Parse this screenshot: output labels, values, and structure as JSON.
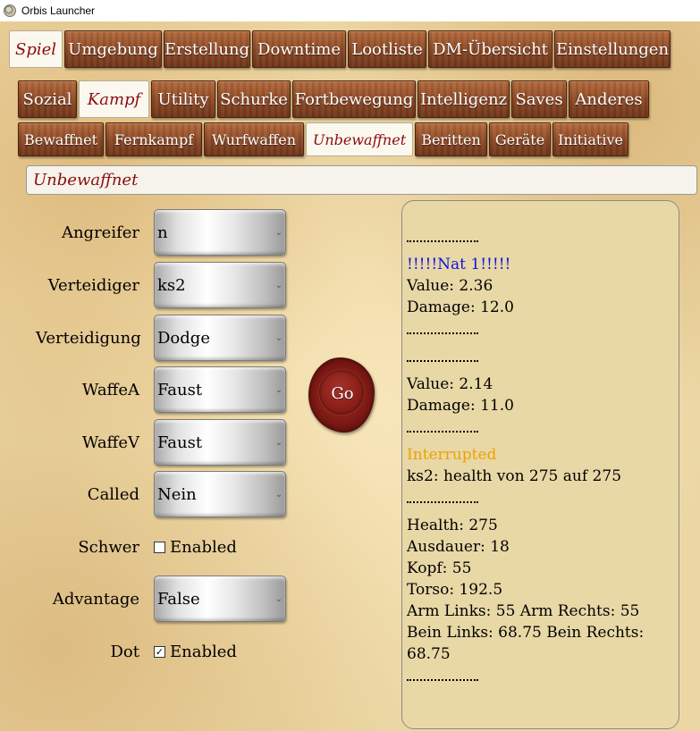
{
  "window": {
    "title": "Orbis Launcher"
  },
  "main_tabs": [
    {
      "label": "Spiel",
      "active": true
    },
    {
      "label": "Umgebung",
      "active": false
    },
    {
      "label": "Erstellung",
      "active": false
    },
    {
      "label": "Downtime",
      "active": false
    },
    {
      "label": "Lootliste",
      "active": false
    },
    {
      "label": "DM-Übersicht",
      "active": false
    },
    {
      "label": "Einstellungen",
      "active": false
    }
  ],
  "sub_tabs": [
    {
      "label": "Sozial",
      "active": false
    },
    {
      "label": "Kampf",
      "active": true
    },
    {
      "label": "Utility",
      "active": false
    },
    {
      "label": "Schurke",
      "active": false
    },
    {
      "label": "Fortbewegung",
      "active": false
    },
    {
      "label": "Intelligenz",
      "active": false
    },
    {
      "label": "Saves",
      "active": false
    },
    {
      "label": "Anderes",
      "active": false
    }
  ],
  "combat_tabs": [
    {
      "label": "Bewaffnet",
      "active": false
    },
    {
      "label": "Fernkampf",
      "active": false
    },
    {
      "label": "Wurfwaffen",
      "active": false
    },
    {
      "label": "Unbewaffnet",
      "active": true
    },
    {
      "label": "Beritten",
      "active": false
    },
    {
      "label": "Geräte",
      "active": false
    },
    {
      "label": "Initiative",
      "active": false
    }
  ],
  "section_title": "Unbewaffnet",
  "form": {
    "angreifer": {
      "label": "Angreifer",
      "value": "n"
    },
    "verteidiger": {
      "label": "Verteidiger",
      "value": "ks2"
    },
    "verteidigung": {
      "label": "Verteidigung",
      "value": "Dodge"
    },
    "waffe_a": {
      "label": "WaffeA",
      "value": "Faust"
    },
    "waffe_v": {
      "label": "WaffeV",
      "value": "Faust"
    },
    "called": {
      "label": "Called",
      "value": "Nein"
    },
    "schwer": {
      "label": "Schwer",
      "checkbox_label": "Enabled",
      "checked": false,
      "mark": ""
    },
    "advantage": {
      "label": "Advantage",
      "value": "False"
    },
    "dot": {
      "label": "Dot",
      "checkbox_label": "Enabled",
      "checked": true,
      "mark": "✓"
    }
  },
  "go_button": {
    "label": "Go"
  },
  "icons": {
    "dropdown": "chevron-down-icon",
    "app": "app-icon"
  },
  "colors": {
    "accent_red": "#8b0d0d",
    "log_blue": "#1111e0",
    "log_orange": "#f0a000",
    "tab_wood": "#8e4a26"
  },
  "log": {
    "nat1": "!!!!!Nat 1!!!!!",
    "value1": "Value: 2.36",
    "damage1": "Damage: 12.0",
    "value2": "Value: 2.14",
    "damage2": "Damage: 11.0",
    "interrupted": "Interrupted",
    "health_change": "ks2: health von 275 auf 275",
    "health": "Health: 275",
    "ausdauer": "Ausdauer: 18",
    "kopf": "Kopf: 55",
    "torso": "Torso: 192.5",
    "arms": "Arm Links: 55 Arm Rechts: 55",
    "legs": "Bein Links: 68.75 Bein Rechts: 68.75"
  }
}
